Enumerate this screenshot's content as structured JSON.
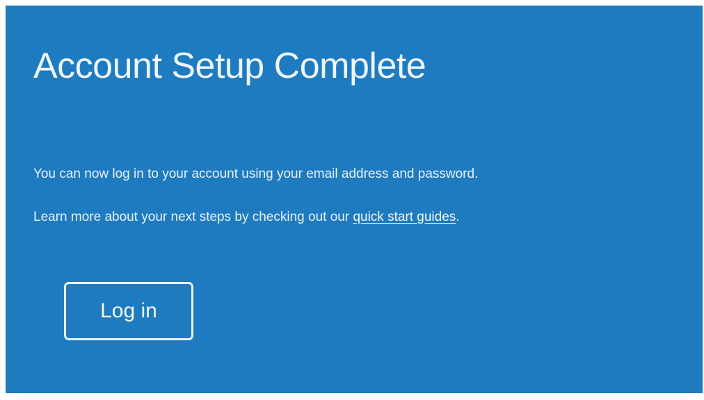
{
  "page": {
    "title": "Account Setup Complete",
    "message_1": "You can now log in to your account using your email address and password.",
    "message_2_prefix": "Learn more about your next steps by checking out our ",
    "message_2_link": "quick start guides",
    "message_2_suffix": "."
  },
  "actions": {
    "login_label": "Log in"
  },
  "colors": {
    "background": "#1f7bbf",
    "text": "#eef6fc"
  }
}
